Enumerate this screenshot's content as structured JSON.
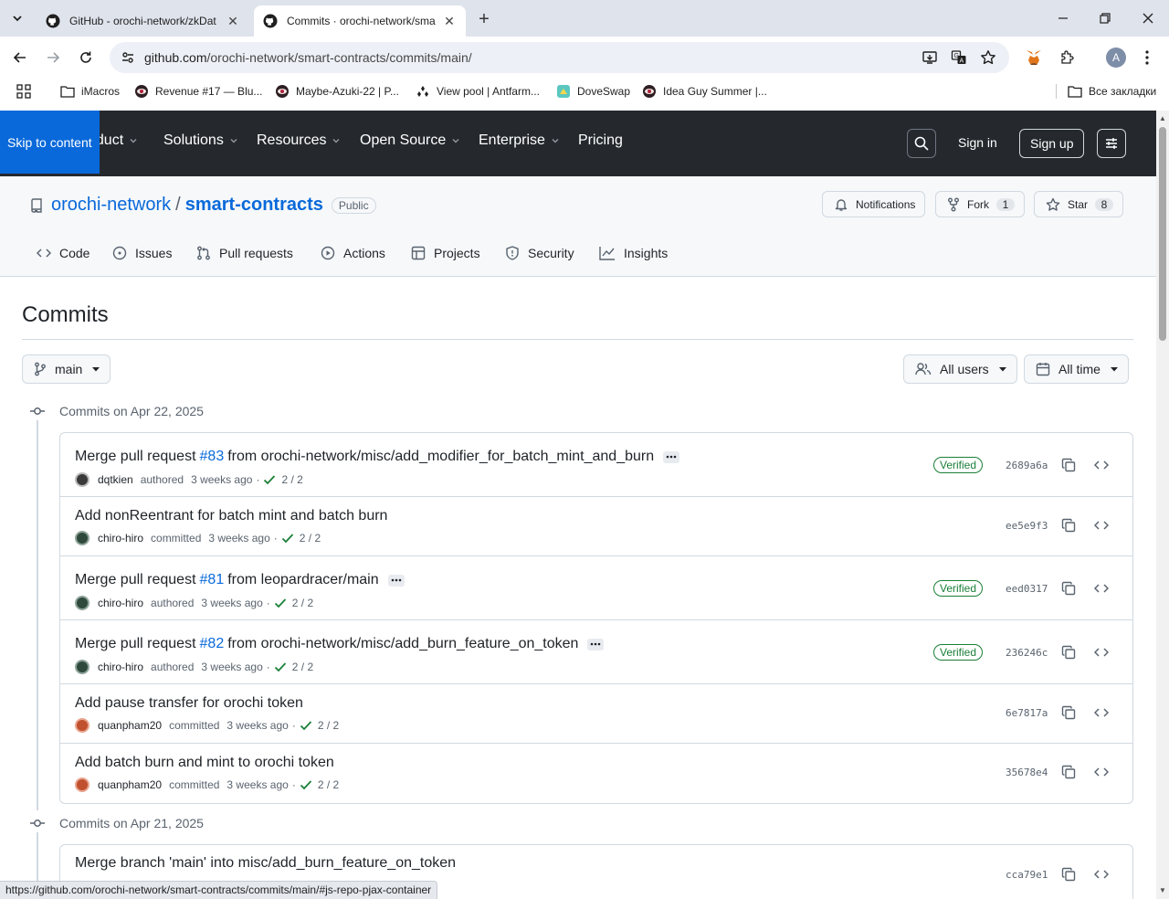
{
  "browser": {
    "tabs": [
      {
        "title": "GitHub - orochi-network/zkDat",
        "active": false
      },
      {
        "title": "Commits · orochi-network/sma",
        "active": true
      }
    ],
    "url_host": "github.com",
    "url_path": "/orochi-network/smart-contracts/commits/main/",
    "profile_initial": "A",
    "bookmarks": [
      {
        "label": "iMacros",
        "icon": "folder-icon"
      },
      {
        "label": "Revenue #17 — Blu...",
        "icon": "eye-avatar-icon"
      },
      {
        "label": "Maybe-Azuki-22 | P...",
        "icon": "eye-avatar-icon"
      },
      {
        "label": "View pool | Antfarm...",
        "icon": "antfarm-icon"
      },
      {
        "label": "DoveSwap",
        "icon": "doveswap-icon"
      },
      {
        "label": "Idea Guy Summer |...",
        "icon": "eye-avatar-icon"
      }
    ],
    "all_bookmarks": "Все закладки",
    "status_url": "https://github.com/orochi-network/smart-contracts/commits/main/#js-repo-pjax-container"
  },
  "gh_header": {
    "skip": "Skip to content",
    "nav": [
      "Product",
      "Solutions",
      "Resources",
      "Open Source",
      "Enterprise",
      "Pricing"
    ],
    "sign_in": "Sign in",
    "sign_up": "Sign up"
  },
  "repo": {
    "owner": "orochi-network",
    "separator": "/",
    "name": "smart-contracts",
    "visibility": "Public",
    "notifications": "Notifications",
    "fork_label": "Fork",
    "fork_count": "1",
    "star_label": "Star",
    "star_count": "8",
    "tabs": [
      "Code",
      "Issues",
      "Pull requests",
      "Actions",
      "Projects",
      "Security",
      "Insights"
    ]
  },
  "page": {
    "title": "Commits",
    "branch": "main",
    "users_filter": "All users",
    "time_filter": "All time"
  },
  "groups": [
    {
      "heading": "Commits on Apr 22, 2025",
      "commits": [
        {
          "pre": "Merge pull request",
          "pr": "#83",
          "post": "from orochi-network/misc/add_modifier_for_batch_mint_and_burn",
          "has_more": true,
          "author": "dqtkien",
          "action": "authored",
          "when": "3 weeks ago",
          "checks": "2 / 2",
          "verified": "Verified",
          "sha": "2689a6a",
          "avatar_color": "#3a3a3a"
        },
        {
          "pre": "Add nonReentrant for batch mint and batch burn",
          "pr": "",
          "post": "",
          "has_more": false,
          "author": "chiro-hiro",
          "action": "committed",
          "when": "3 weeks ago",
          "checks": "2 / 2",
          "verified": "",
          "sha": "ee5e9f3",
          "avatar_color": "#2f4a3c"
        },
        {
          "pre": "Merge pull request",
          "pr": "#81",
          "post": "from leopardracer/main",
          "has_more": true,
          "author": "chiro-hiro",
          "action": "authored",
          "when": "3 weeks ago",
          "checks": "2 / 2",
          "verified": "Verified",
          "sha": "eed0317",
          "avatar_color": "#2f4a3c"
        },
        {
          "pre": "Merge pull request",
          "pr": "#82",
          "post": "from orochi-network/misc/add_burn_feature_on_token",
          "has_more": true,
          "author": "chiro-hiro",
          "action": "authored",
          "when": "3 weeks ago",
          "checks": "2 / 2",
          "verified": "Verified",
          "sha": "236246c",
          "avatar_color": "#2f4a3c"
        },
        {
          "pre": "Add pause transfer for orochi token",
          "pr": "",
          "post": "",
          "has_more": false,
          "author": "quanpham20",
          "action": "committed",
          "when": "3 weeks ago",
          "checks": "2 / 2",
          "verified": "",
          "sha": "6e7817a",
          "avatar_color": "#c0502e"
        },
        {
          "pre": "Add batch burn and mint to orochi token",
          "pr": "",
          "post": "",
          "has_more": false,
          "author": "quanpham20",
          "action": "committed",
          "when": "3 weeks ago",
          "checks": "2 / 2",
          "verified": "",
          "sha": "35678e4",
          "avatar_color": "#c0502e"
        }
      ]
    },
    {
      "heading": "Commits on Apr 21, 2025",
      "commits": [
        {
          "pre": "Merge branch 'main' into misc/add_burn_feature_on_token",
          "pr": "",
          "post": "",
          "has_more": false,
          "sha": "cca79e1"
        }
      ]
    }
  ],
  "colors": {
    "header_bg": "#25292e",
    "link": "#0969da",
    "verified": "#1a7f37",
    "skip_bg": "#0969da"
  }
}
